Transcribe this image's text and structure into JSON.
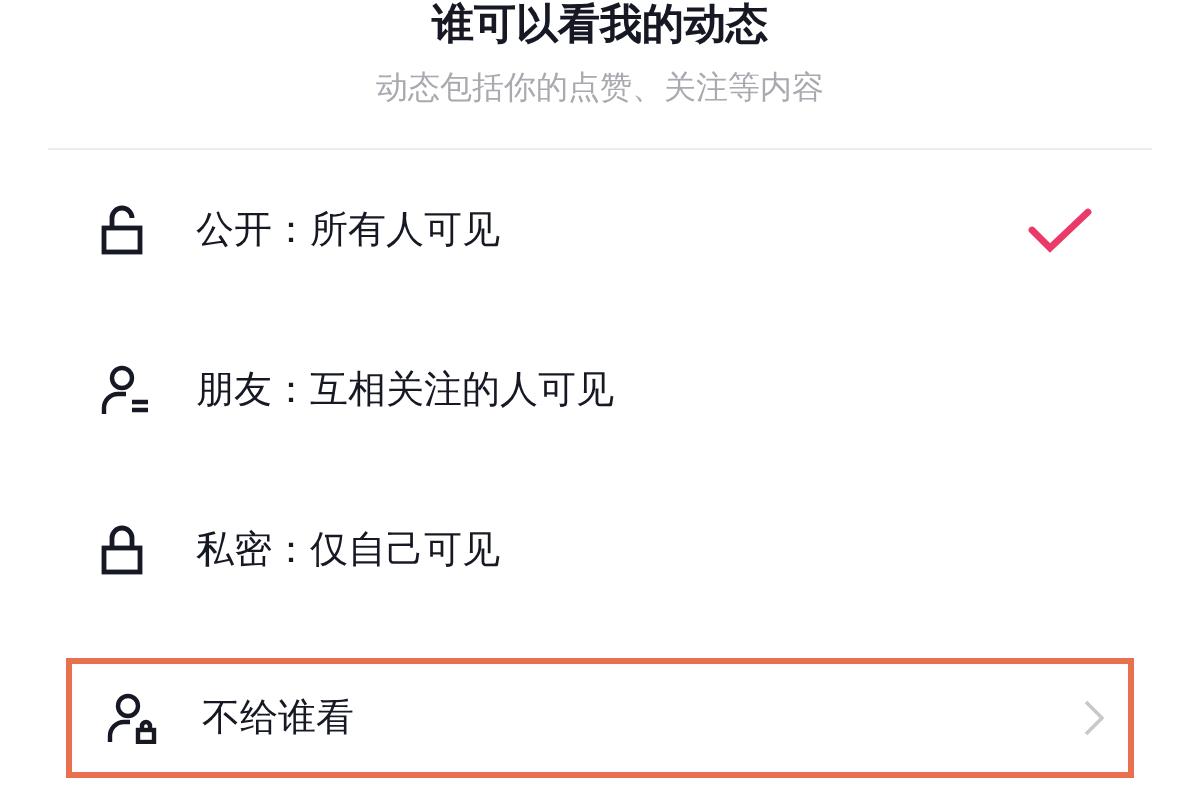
{
  "header": {
    "title": "谁可以看我的动态",
    "subtitle": "动态包括你的点赞、关注等内容"
  },
  "options": [
    {
      "kind": "public",
      "label": "公开：所有人可见",
      "selected": true,
      "highlighted": false
    },
    {
      "kind": "friends",
      "label": "朋友：互相关注的人可见",
      "selected": false,
      "highlighted": false
    },
    {
      "kind": "private",
      "label": "私密：仅自己可见",
      "selected": false,
      "highlighted": false
    },
    {
      "kind": "exclude",
      "label": "不给谁看",
      "selected": false,
      "highlighted": true
    }
  ]
}
